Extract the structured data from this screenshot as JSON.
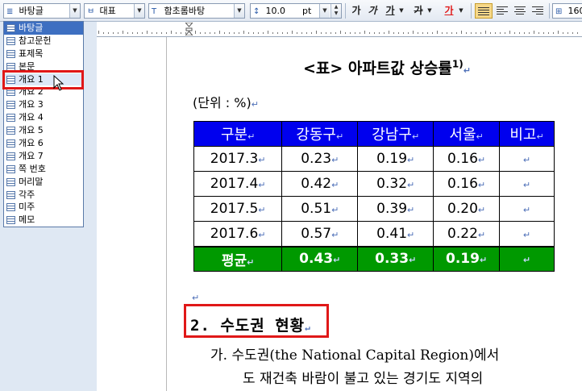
{
  "toolbar": {
    "style_value": "바탕글",
    "lang_value": "대표",
    "font_value": "함초롬바탕",
    "size_value": "10.0",
    "size_unit": "pt",
    "bold_label": "가",
    "italic_label": "가",
    "underline_label": "가",
    "strike_label": "가",
    "color_label": "가",
    "zoom_value": "160"
  },
  "style_list": {
    "items": [
      {
        "label": "바탕글"
      },
      {
        "label": "참고문헌"
      },
      {
        "label": "표제목"
      },
      {
        "label": "본문"
      },
      {
        "label": "개요 1"
      },
      {
        "label": "개요 2"
      },
      {
        "label": "개요 3"
      },
      {
        "label": "개요 4"
      },
      {
        "label": "개요 5"
      },
      {
        "label": "개요 6"
      },
      {
        "label": "개요 7"
      },
      {
        "label": "쪽 번호"
      },
      {
        "label": "머리말"
      },
      {
        "label": "각주"
      },
      {
        "label": "미주"
      },
      {
        "label": "메모"
      }
    ]
  },
  "document": {
    "table_title": "<표> 아파트값 상승률",
    "footnote": "1)",
    "unit_label": "(단위 : %)",
    "para_mark": "↵",
    "table": {
      "headers": [
        "구분",
        "강동구",
        "강남구",
        "서울",
        "비고"
      ],
      "rows": [
        [
          "2017.3",
          "0.23",
          "0.19",
          "0.16",
          ""
        ],
        [
          "2017.4",
          "0.42",
          "0.32",
          "0.16",
          ""
        ],
        [
          "2017.5",
          "0.51",
          "0.39",
          "0.20",
          ""
        ],
        [
          "2017.6",
          "0.57",
          "0.41",
          "0.22",
          ""
        ]
      ],
      "average_row": [
        "평균",
        "0.43",
        "0.33",
        "0.19",
        ""
      ]
    },
    "heading": "2. 수도권 현황",
    "body_line1": "가. 수도권(the National Capital Region)에서",
    "body_line2": "도 재건축 바람이 불고 있는 경기도 지역의"
  },
  "colors": {
    "header_fill": "#0000ee",
    "average_fill": "#009900",
    "highlight_box": "#e01818",
    "selected_item": "#3d6fc1"
  }
}
